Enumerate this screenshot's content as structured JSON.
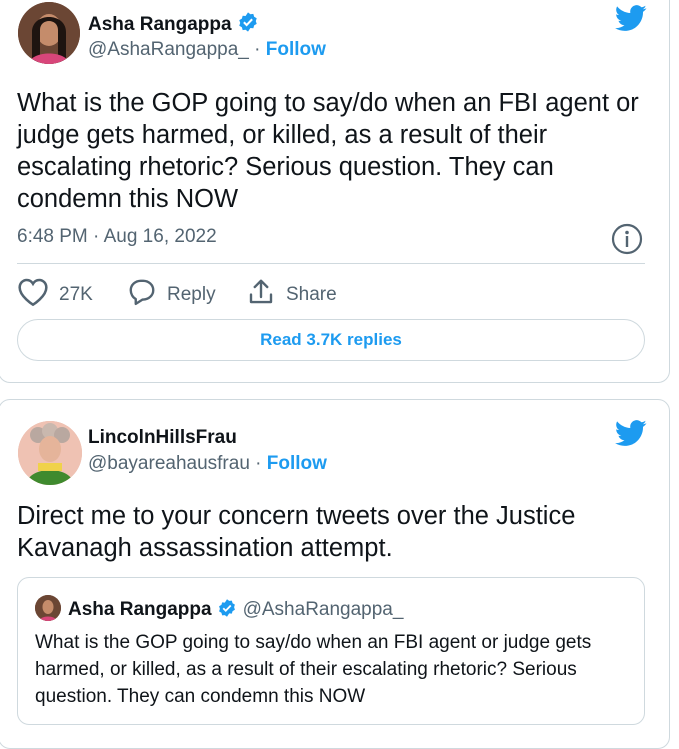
{
  "tweet1": {
    "name": "Asha Rangappa",
    "handle": "@AshaRangappa_",
    "separator": " · ",
    "follow": "Follow",
    "text": "What is the GOP going to say/do when an FBI agent or judge gets harmed, or killed, as a result of their escalating rhetoric? Serious question. They can condemn this NOW",
    "timestamp": "6:48 PM · Aug 16, 2022",
    "likes": "27K",
    "reply_label": "Reply",
    "share_label": "Share",
    "read_replies": "Read 3.7K replies"
  },
  "tweet2": {
    "name": "LincolnHillsFrau",
    "handle": "@bayareahausfrau",
    "separator": " · ",
    "follow": "Follow",
    "text": "Direct me to your concern tweets over the Justice Kavanagh assassination attempt.",
    "quote": {
      "name": "Asha Rangappa",
      "handle": "@AshaRangappa_",
      "text": "What is the GOP going to say/do when an FBI agent or judge gets harmed, or killed, as a result of their escalating rhetoric? Serious question. They can condemn this NOW"
    }
  },
  "colors": {
    "accent": "#1d9bf0",
    "secondary_text": "#536471",
    "border": "#cfd9de"
  },
  "icons": [
    "verified-badge-icon",
    "twitter-bird-icon",
    "info-icon",
    "heart-icon",
    "reply-icon",
    "share-icon"
  ]
}
